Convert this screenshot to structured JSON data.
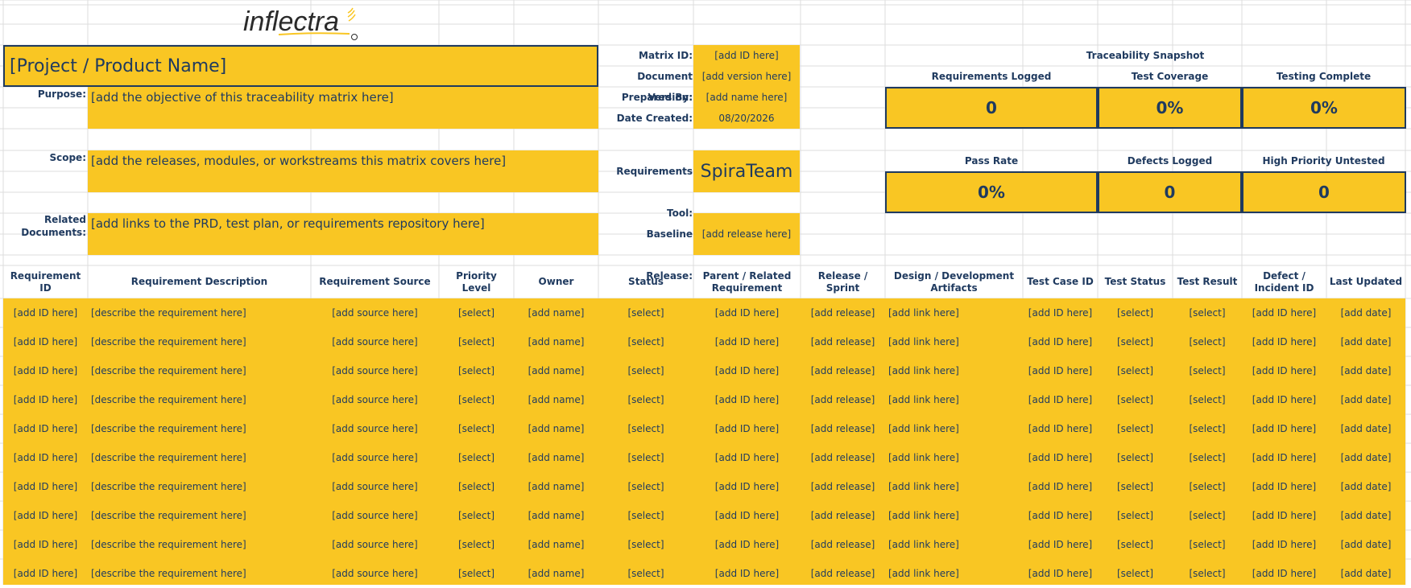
{
  "brand": {
    "logo_text": "inflectra"
  },
  "project": {
    "name": "[Project / Product Name]",
    "purpose_label": "Purpose:",
    "purpose_value": "[add the objective of this traceability matrix here]",
    "scope_label": "Scope:",
    "scope_value": "[add the releases, modules, or workstreams this matrix covers here]",
    "related_label_1": "Related",
    "related_label_2": "Documents:",
    "related_value": "[add links to the PRD, test plan, or requirements repository here]"
  },
  "meta": {
    "matrix_id_label": "Matrix ID:",
    "matrix_id_value": "[add ID here]",
    "doc_version_label": "Document Version:",
    "doc_version_value": "[add version here]",
    "prepared_by_label": "Prepared By:",
    "prepared_by_value": "[add name here]",
    "date_created_label": "Date Created:",
    "date_created_value": "08/20/2026",
    "req_tool_label": "Requirements Tool:",
    "req_tool_value": "SpiraTeam",
    "baseline_label": "Baseline Release:",
    "baseline_value": "[add release here]"
  },
  "snapshot": {
    "title": "Traceability Snapshot",
    "kpis": [
      {
        "label": "Requirements Logged",
        "value": "0"
      },
      {
        "label": "Test Coverage",
        "value": "0%"
      },
      {
        "label": "Testing Complete",
        "value": "0%"
      },
      {
        "label": "Pass Rate",
        "value": "0%"
      },
      {
        "label": "Defects Logged",
        "value": "0"
      },
      {
        "label": "High Priority Untested",
        "value": "0"
      }
    ]
  },
  "table": {
    "headers": [
      "Requirement ID",
      "Requirement Description",
      "Requirement Source",
      "Priority Level",
      "Owner",
      "Status",
      "Parent / Related Requirement",
      "Release / Sprint",
      "Design / Development Artifacts",
      "Test Case ID",
      "Test Status",
      "Test Result",
      "Defect / Incident ID",
      "Last Updated"
    ],
    "row_template": [
      "[add ID here]",
      "[describe the requirement here]",
      "[add source here]",
      "[select]",
      "[add name]",
      "[select]",
      "[add ID here]",
      "[add release]",
      "[add link here]",
      "[add ID here]",
      "[select]",
      "[select]",
      "[add ID here]",
      "[add date]"
    ],
    "row_count": 10
  },
  "colors": {
    "accent": "#f9c623",
    "text": "#1f3a5f",
    "grid": "#d9d9d9"
  }
}
